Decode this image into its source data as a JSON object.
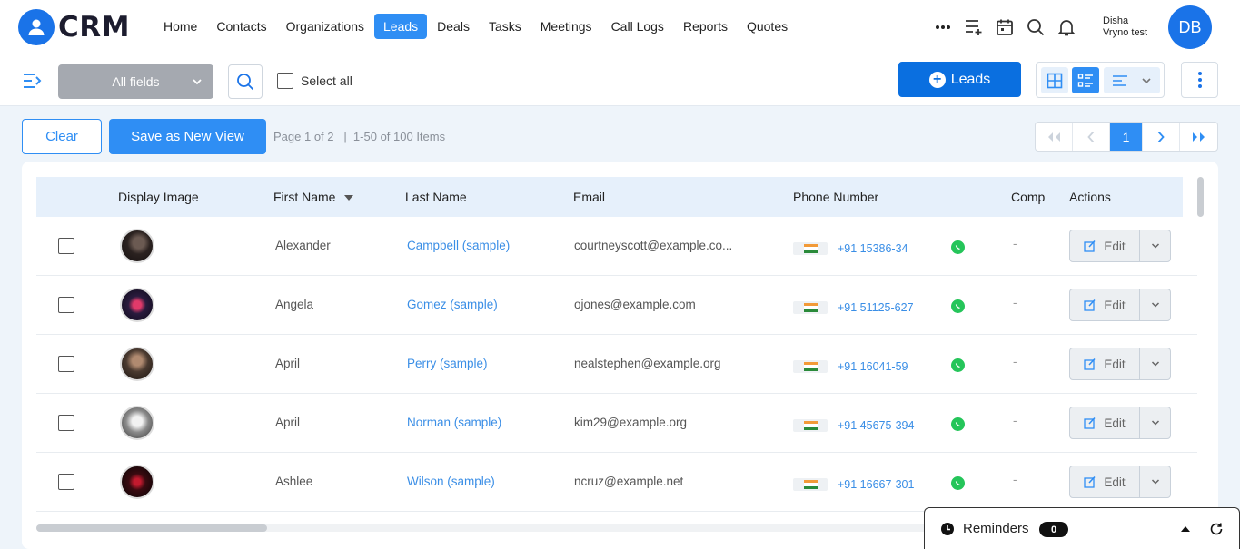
{
  "app": {
    "logo_text": "CRM"
  },
  "nav": {
    "items": [
      {
        "label": "Home",
        "active": false
      },
      {
        "label": "Contacts",
        "active": false
      },
      {
        "label": "Organizations",
        "active": false
      },
      {
        "label": "Leads",
        "active": true
      },
      {
        "label": "Deals",
        "active": false
      },
      {
        "label": "Tasks",
        "active": false
      },
      {
        "label": "Meetings",
        "active": false
      },
      {
        "label": "Call Logs",
        "active": false
      },
      {
        "label": "Reports",
        "active": false
      },
      {
        "label": "Quotes",
        "active": false
      }
    ],
    "more_icon": "more-horizontal-icon",
    "icons": [
      "add-list-icon",
      "calendar-icon",
      "search-icon",
      "bell-icon"
    ],
    "user": {
      "name": "Disha",
      "org": "Vryno test",
      "initials": "DB"
    }
  },
  "toolbar": {
    "field_select": "All fields",
    "select_all_label": "Select all",
    "add_button_label": "Leads"
  },
  "actions": {
    "clear_label": "Clear",
    "save_view_label": "Save as New View",
    "page_info": "Page 1 of 2   |  1-50 of 100 Items",
    "current_page": "1"
  },
  "table": {
    "headers": {
      "display_image": "Display Image",
      "first_name": "First Name",
      "last_name": "Last Name",
      "email": "Email",
      "phone": "Phone Number",
      "company": "Comp",
      "actions": "Actions"
    },
    "edit_label": "Edit",
    "rows": [
      {
        "first_name": "Alexander",
        "last_name": "Campbell (sample)",
        "email": "courtneyscott@example.co...",
        "phone": "+91 15386-34",
        "company": "-"
      },
      {
        "first_name": "Angela",
        "last_name": "Gomez (sample)",
        "email": "ojones@example.com",
        "phone": "+91 51125-627",
        "company": "-"
      },
      {
        "first_name": "April",
        "last_name": "Perry (sample)",
        "email": "nealstephen@example.org",
        "phone": "+91 16041-59",
        "company": "-"
      },
      {
        "first_name": "April",
        "last_name": "Norman (sample)",
        "email": "kim29@example.org",
        "phone": "+91 45675-394",
        "company": "-"
      },
      {
        "first_name": "Ashlee",
        "last_name": "Wilson (sample)",
        "email": "ncruz@example.net",
        "phone": "+91 16667-301",
        "company": "-"
      }
    ]
  },
  "reminders": {
    "label": "Reminders",
    "count": "0"
  },
  "colors": {
    "accent": "#2f8ef4",
    "primary": "#0a6fe0",
    "link": "#3a8ee6",
    "whatsapp": "#25c55a"
  }
}
